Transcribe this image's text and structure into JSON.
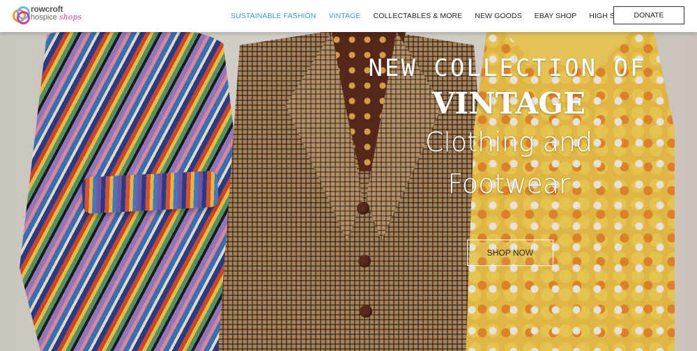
{
  "brand": {
    "name_top": "rowcroft",
    "name_bottom": "hospice",
    "name_script": "shops"
  },
  "nav": {
    "items": [
      {
        "label": "SUSTAINABLE FASHION",
        "active": true
      },
      {
        "label": "VINTAGE",
        "active": true
      },
      {
        "label": "COLLECTABLES & MORE",
        "active": false
      },
      {
        "label": "NEW GOODS",
        "active": false
      },
      {
        "label": "EBAY SHOP",
        "active": false
      },
      {
        "label": "HIGH STREET STORES",
        "active": false
      }
    ],
    "donate_label": "DONATE"
  },
  "hero": {
    "line1": "NEW COLLECTION OF",
    "line2": "VINTAGE",
    "line3a": "Clothing and",
    "line3b": "Footwear",
    "cta_label": "SHOP NOW"
  },
  "colors": {
    "accent": "#3b9bc6",
    "logo_pink": "#c2479b",
    "logo_orange": "#f29b2c",
    "logo_blue": "#6fb6e3"
  }
}
